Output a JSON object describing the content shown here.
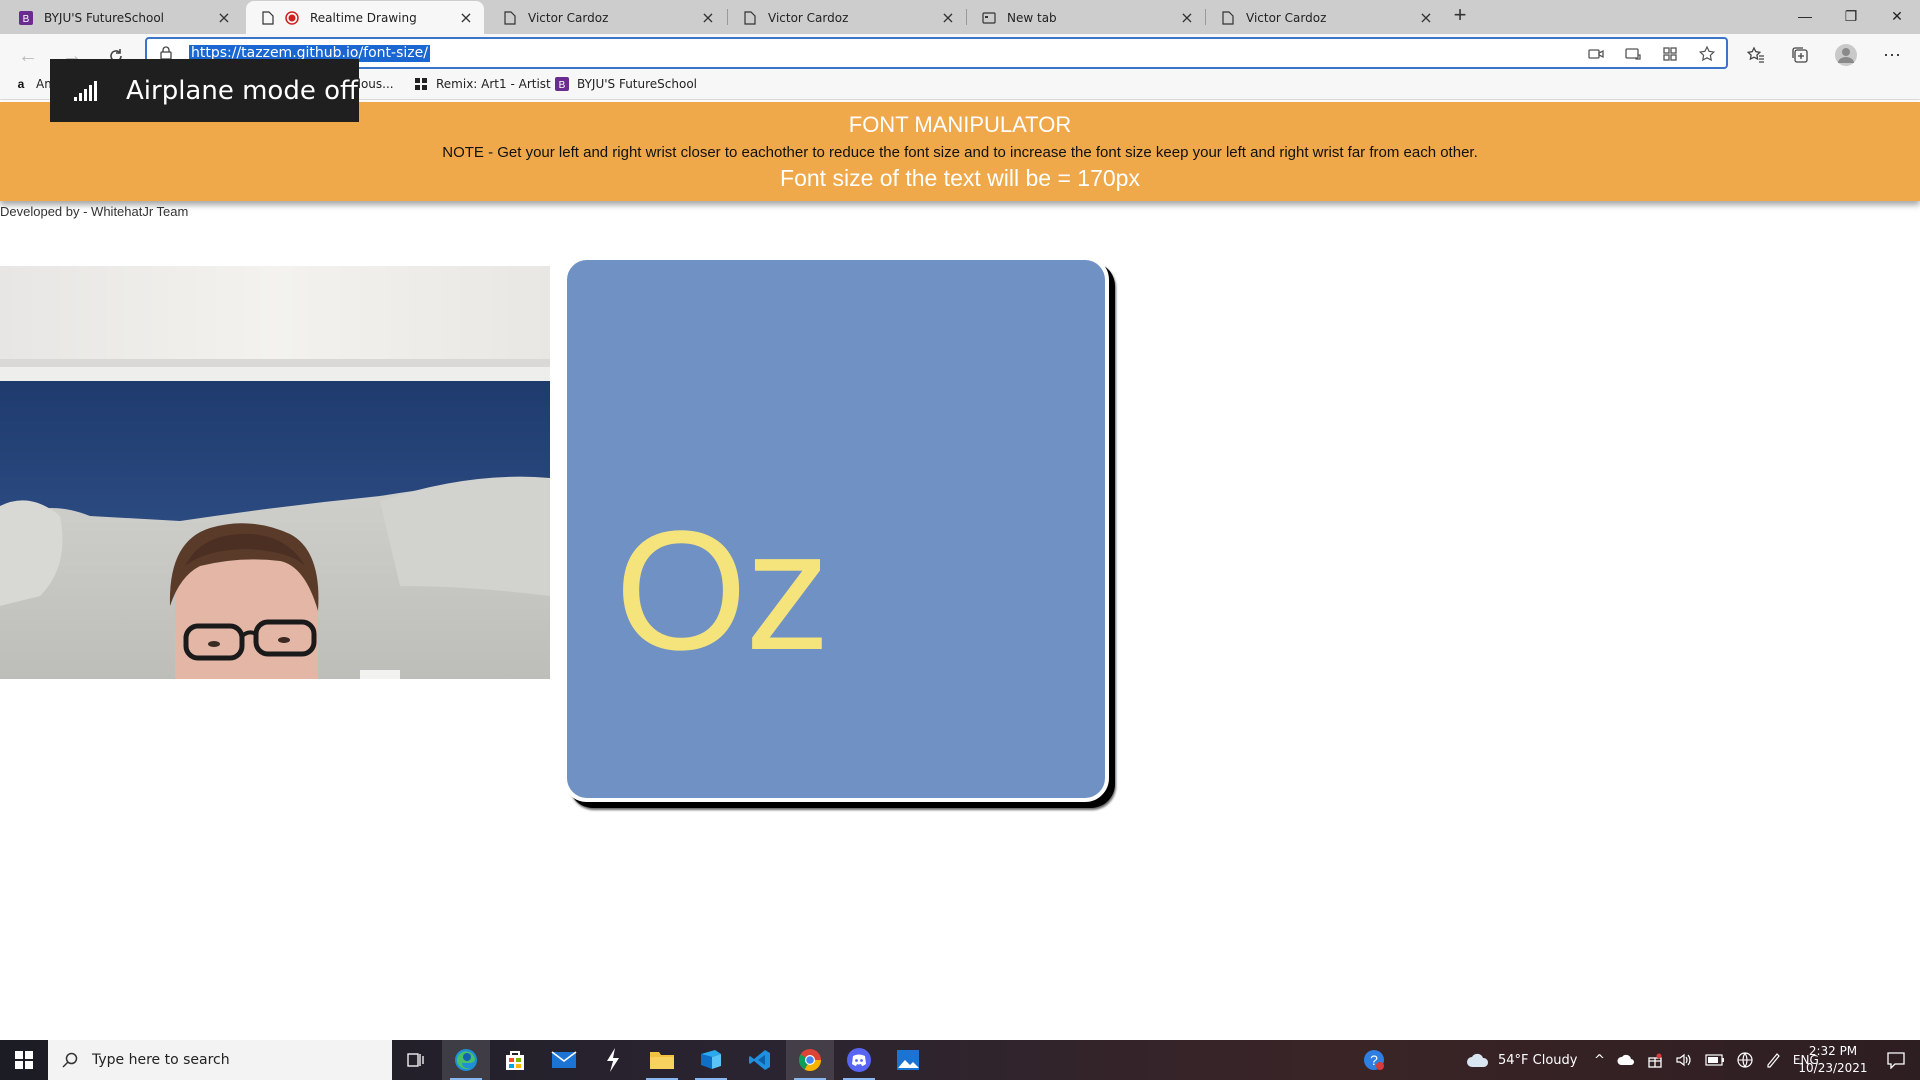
{
  "browser": {
    "tabs": [
      {
        "label": "BYJU'S FutureSchool",
        "icon": "byjus-icon",
        "active": false
      },
      {
        "label": "Realtime Drawing",
        "icon": "recording-icon",
        "active": true
      },
      {
        "label": "Victor Cardoz",
        "icon": "page-icon",
        "active": false
      },
      {
        "label": "Victor Cardoz",
        "icon": "page-icon",
        "active": false
      },
      {
        "label": "New tab",
        "icon": "newtab-page-icon",
        "active": false
      },
      {
        "label": "Victor Cardoz",
        "icon": "page-icon",
        "active": false
      }
    ],
    "url": "https://tazzem.github.io/font-size/",
    "favorites": [
      {
        "label": "Am",
        "icon": "amazon-icon"
      },
      {
        "label": "ulous...",
        "icon": "page-icon"
      },
      {
        "label": "Remix: Art1 - Artist",
        "icon": "scratch-icon"
      },
      {
        "label": "BYJU'S FutureSchool",
        "icon": "byjus-icon"
      }
    ],
    "accent_color": "#1a67d2"
  },
  "toast": {
    "label": "Airplane mode off",
    "icon": "signal-bars-icon"
  },
  "page": {
    "header_color": "#efa94a",
    "title": "FONT MANIPULATOR",
    "note": "NOTE - Get your left and right wrist closer to eachother to reduce the font size and to increase the font size keep your left and right wrist far from each other.",
    "size_text": "Font size of the text will be = 170px",
    "developed_by": "Developed by - WhitehatJr Team",
    "canvas_text": "Oz",
    "canvas_bg": "#6f91c4",
    "canvas_text_color": "#f5e37c"
  },
  "taskbar": {
    "search_placeholder": "Type here to search",
    "apps": [
      "task-view-icon",
      "edge-icon",
      "store-icon",
      "mail-icon",
      "lightning-icon",
      "file-explorer-icon",
      "azure-icon",
      "vscode-icon",
      "chrome-icon",
      "discord-icon",
      "photos-icon"
    ],
    "weather": "54°F  Cloudy",
    "language": "ENG",
    "time": "2:32 PM",
    "date": "10/23/2021"
  }
}
